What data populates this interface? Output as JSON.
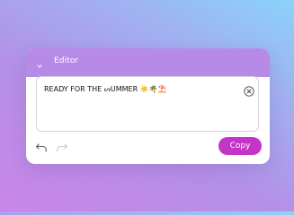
{
  "editor": {
    "title": "Editor",
    "text_value": "READY FOR THE ᔕUMMER ☀️🌴⛱️",
    "copy_label": "Copy",
    "colors": {
      "header": "#b88ae8",
      "copy_button": "#c235c6",
      "card": "#ffffff"
    },
    "icons": {
      "collapse": "chevron-down-icon",
      "clear": "clear-circle-x-icon",
      "undo": "undo-arrow-icon",
      "redo": "redo-arrow-icon"
    },
    "redo_enabled": false
  }
}
